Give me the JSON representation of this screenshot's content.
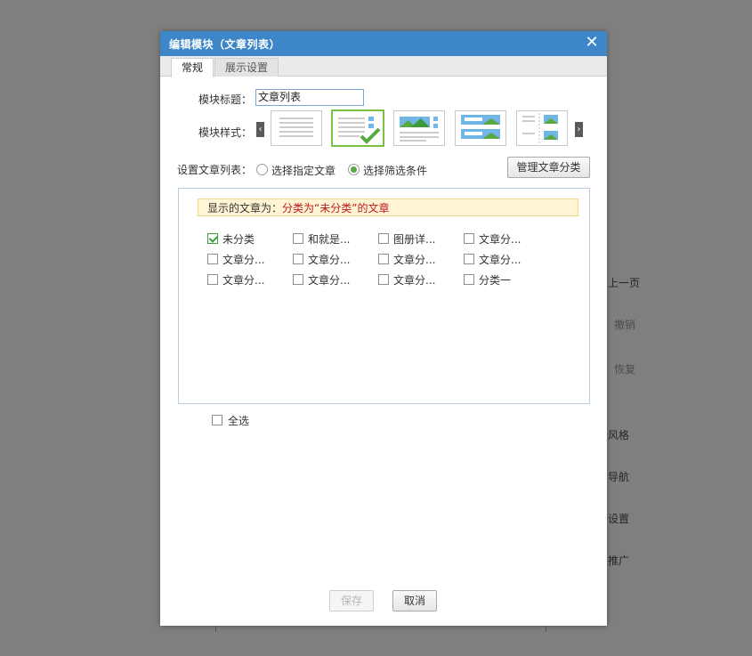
{
  "background_menu": {
    "items": [
      {
        "label": "上一页",
        "dim": false
      },
      {
        "label": "撤销",
        "dim": true
      },
      {
        "label": "恢复",
        "dim": true
      },
      {
        "label": "风格",
        "dim": false
      },
      {
        "label": "导航",
        "dim": false
      },
      {
        "label": "设置",
        "dim": false
      },
      {
        "label": "推广",
        "dim": false
      }
    ]
  },
  "dialog": {
    "title": "编辑模块（文章列表）",
    "close_icon": "close-icon",
    "tabs": [
      {
        "label": "常规",
        "active": true
      },
      {
        "label": "展示设置",
        "active": false
      }
    ],
    "module_title_label": "模块标题：",
    "module_title_value": "文章列表",
    "module_style_label": "模块样式：",
    "style_options": [
      {
        "name": "plain-list",
        "selected": false
      },
      {
        "name": "list-with-icons",
        "selected": true
      },
      {
        "name": "image-list",
        "selected": false
      },
      {
        "name": "banner-list",
        "selected": false
      },
      {
        "name": "image-grid",
        "selected": false
      }
    ],
    "set_list_label": "设置文章列表：",
    "radio_options": [
      {
        "label": "选择指定文章",
        "checked": false
      },
      {
        "label": "选择筛选条件",
        "checked": true
      }
    ],
    "manage_button": "管理文章分类",
    "notice_prefix": "显示的文章为：",
    "notice_highlight": "分类为“未分类”的文章",
    "categories": [
      {
        "label": "未分类",
        "checked": true
      },
      {
        "label": "和就是...",
        "checked": false
      },
      {
        "label": "图册详...",
        "checked": false
      },
      {
        "label": "文章分...",
        "checked": false
      },
      {
        "label": "文章分...",
        "checked": false
      },
      {
        "label": "文章分...",
        "checked": false
      },
      {
        "label": "文章分...",
        "checked": false
      },
      {
        "label": "文章分...",
        "checked": false
      },
      {
        "label": "文章分...",
        "checked": false
      },
      {
        "label": "文章分...",
        "checked": false
      },
      {
        "label": "文章分...",
        "checked": false
      },
      {
        "label": "分类一",
        "checked": false
      }
    ],
    "select_all_label": "全选",
    "select_all_checked": false,
    "save_button": "保存",
    "save_disabled": true,
    "cancel_button": "取消",
    "colors": {
      "titlebar": "#3d87c9",
      "selected_border": "#7cc142",
      "highlight_text": "#c0171d",
      "notice_bg": "#fff5d4"
    }
  }
}
